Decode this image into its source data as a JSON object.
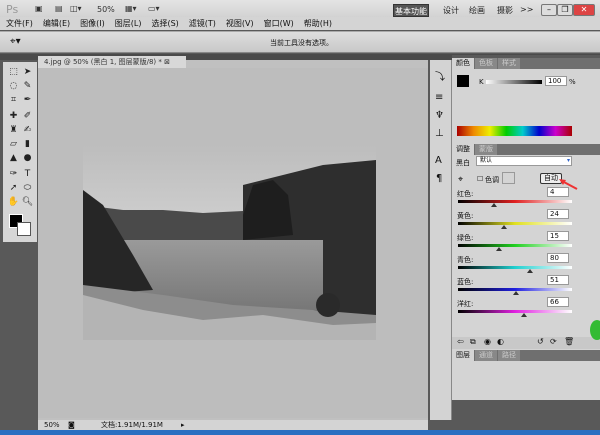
{
  "app": {
    "logo": "Ps",
    "zoom": "50%"
  },
  "workspace": {
    "active": "基本功能",
    "items": [
      "设计",
      "绘画",
      "摄影"
    ],
    "more": ">>"
  },
  "menu": [
    "文件(F)",
    "编辑(E)",
    "图像(I)",
    "图层(L)",
    "选择(S)",
    "滤镜(T)",
    "视图(V)",
    "窗口(W)",
    "帮助(H)"
  ],
  "options": {
    "message": "当前工具没有选项。"
  },
  "document": {
    "tab": "4.jpg @ 50% (黑白 1, 图层蒙版/8) *",
    "zoom": "50%",
    "docinfo": "文档:1.91M/1.91M"
  },
  "color_panel": {
    "tabs": [
      "颜色",
      "色板",
      "样式"
    ],
    "channel": "K",
    "value": "100",
    "unit": "%",
    "fg": "#000000",
    "bg": "#ffffff"
  },
  "adjust_panel": {
    "tabs": [
      "调整",
      "蒙版"
    ],
    "type_label": "黑白",
    "preset": "默认",
    "tint_label": "色调",
    "auto_button": "自动",
    "sliders": [
      {
        "label": "红色:",
        "value": "4",
        "color": "#e02020"
      },
      {
        "label": "黄色:",
        "value": "24",
        "color": "#e0e020"
      },
      {
        "label": "绿色:",
        "value": "15",
        "color": "#20d020"
      },
      {
        "label": "青色:",
        "value": "80",
        "color": "#20d0d0"
      },
      {
        "label": "蓝色:",
        "value": "51",
        "color": "#2020e0"
      },
      {
        "label": "洋红:",
        "value": "66",
        "color": "#e020e0"
      }
    ]
  },
  "layers_panel": {
    "tabs": [
      "图层",
      "通道",
      "路径"
    ]
  }
}
